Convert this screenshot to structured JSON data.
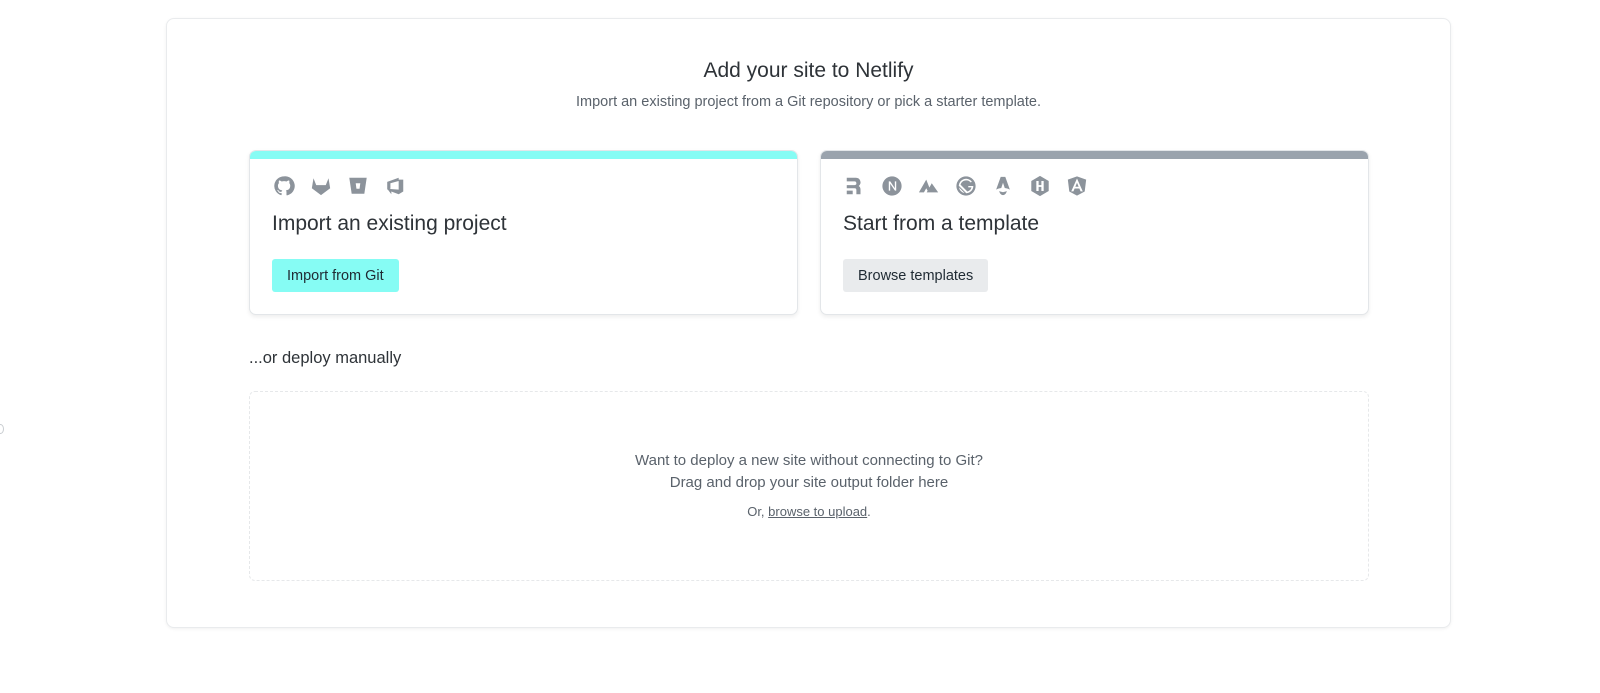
{
  "header": {
    "title": "Add your site to Netlify",
    "subtitle": "Import an existing project from a Git repository or pick a starter template."
  },
  "import_card": {
    "title": "Import an existing project",
    "button_label": "Import from Git",
    "accent_color": "#86fcf4",
    "icons": [
      "github-icon",
      "gitlab-icon",
      "bitbucket-icon",
      "azure-devops-icon"
    ]
  },
  "template_card": {
    "title": "Start from a template",
    "button_label": "Browse templates",
    "accent_color": "#9aa3ad",
    "icons": [
      "remix-icon",
      "nextjs-icon",
      "nuxt-icon",
      "gatsby-icon",
      "astro-icon",
      "hugo-icon",
      "angular-icon"
    ]
  },
  "manual": {
    "label": "...or deploy manually",
    "line1": "Want to deploy a new site without connecting to Git?",
    "line2": "Drag and drop your site output folder here",
    "prefix": "Or, ",
    "link_label": "browse to upload",
    "suffix": "."
  }
}
